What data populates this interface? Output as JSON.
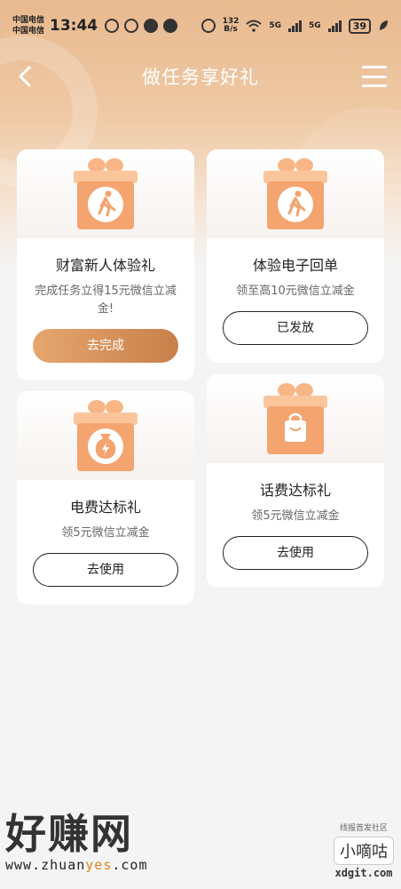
{
  "status_bar": {
    "carrier1": "中国电信",
    "carrier2": "中国电信",
    "time": "13:44",
    "net_speed_value": "132",
    "net_speed_unit": "B/s",
    "sig1_label": "5G",
    "sig2_label": "5G",
    "battery": "39"
  },
  "nav": {
    "title": "做任务享好礼"
  },
  "cards": [
    {
      "title": "财富新人体验礼",
      "desc": "完成任务立得15元微信立减金!",
      "button": "去完成",
      "icon": "running-person-icon"
    },
    {
      "title": "体验电子回单",
      "desc": "领至高10元微信立减金",
      "button": "已发放",
      "icon": "running-person-icon"
    },
    {
      "title": "电费达标礼",
      "desc": "领5元微信立减金",
      "button": "去使用",
      "icon": "money-bag-lightning-icon"
    },
    {
      "title": "话费达标礼",
      "desc": "领5元微信立减金",
      "button": "去使用",
      "icon": "shopping-bag-icon"
    }
  ],
  "watermark": {
    "left_big": "好赚网",
    "left_url_pre": "www.zhuan",
    "left_url_mid": "yes",
    "left_url_post": ".com",
    "right_small": "线报首发社区",
    "right_badge": "小嘀咕",
    "right_url": "xdgit.com"
  },
  "colors": {
    "accent_gradient_start": "#e6a66f",
    "accent_gradient_end": "#c8804a",
    "gift_orange": "#f4a46f",
    "header_bg": "#e8b98f"
  }
}
